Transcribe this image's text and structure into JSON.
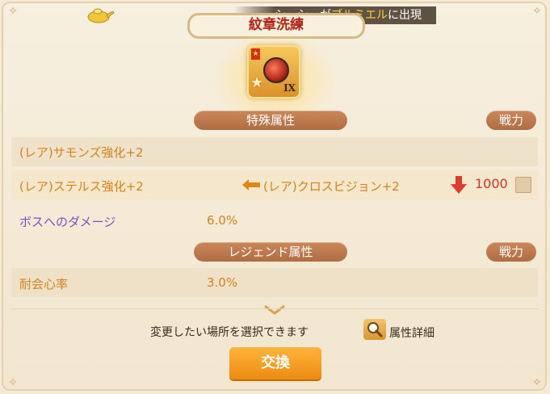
{
  "notice": {
    "before": "シュシュが",
    "highlight": "ブルミエル",
    "after": "に出現"
  },
  "title": "紋章洗練",
  "emblem": {
    "rank": "IX",
    "icon": "emblem-icon"
  },
  "special_attr": {
    "header": "特殊属性",
    "power_button": "戦力",
    "rows": [
      {
        "current": "(レア)サモンズ強化+2"
      },
      {
        "current": "(レア)ステルス強化+2",
        "new": "(レア)クロスビジョン+2",
        "power_change": "1000",
        "change_direction": "down"
      },
      {
        "current": "ボスへのダメージ",
        "value": "6.0%"
      }
    ]
  },
  "legend_attr": {
    "header": "レジェンド属性",
    "power_button": "戦力",
    "rows": [
      {
        "current": "耐会心率",
        "value": "3.0%"
      }
    ]
  },
  "footer": {
    "instruction": "変更したい場所を選択できます",
    "detail_label": "属性詳細",
    "exchange_label": "交換"
  },
  "colors": {
    "accent_orange": "#ee8a10",
    "pill_brown": "#b06d42",
    "attr_orange": "#d4831c",
    "attr_purple": "#7a4fc8",
    "decrease_red": "#d2322a"
  }
}
